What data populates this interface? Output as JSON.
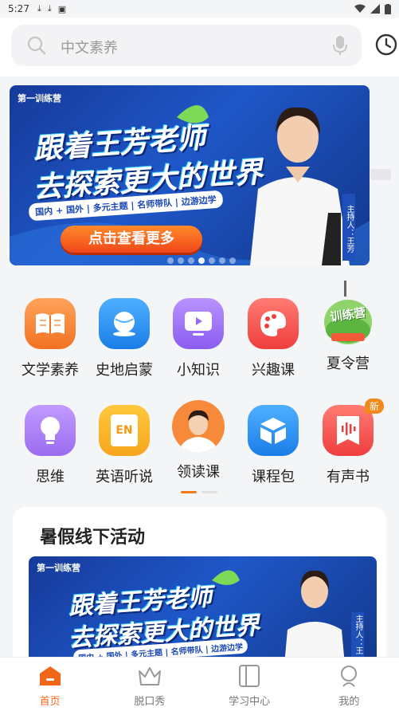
{
  "status_bar": {
    "time": "5:27"
  },
  "search": {
    "placeholder": "中文素养"
  },
  "banner": {
    "camp_label": "第一训练营",
    "headline_1": "跟着王芳老师",
    "headline_2": "去探索更大的世界",
    "tags": "国内 + 国外 | 多元主题 | 名师带队 | 边游边学",
    "cta": "点击查看更多",
    "host": "主持人：王芳",
    "slide_count": 7,
    "active_slide": 4
  },
  "grid_row1": [
    {
      "label": "文学素养",
      "icon": "book-icon",
      "color": "#f6893a"
    },
    {
      "label": "史地启蒙",
      "icon": "planet-icon",
      "color": "#2a8df2"
    },
    {
      "label": "小知识",
      "icon": "monitor-play-icon",
      "color": "#9b6cf0"
    },
    {
      "label": "兴趣课",
      "icon": "palette-icon",
      "color": "#f2564f"
    },
    {
      "label": "夏令营",
      "icon": "camp-illustration",
      "color": "#4bbf55",
      "art_text": "训练营"
    }
  ],
  "grid_row2": [
    {
      "label": "思维",
      "icon": "lightbulb-icon",
      "color": "#a672f0"
    },
    {
      "label": "英语听说",
      "icon": "english-book-icon",
      "color": "#f9b42a",
      "art_text": "EN"
    },
    {
      "label": "领读课",
      "icon": "teacher-avatar",
      "color": "#f6893a"
    },
    {
      "label": "课程包",
      "icon": "package-icon",
      "color": "#2a8df2"
    },
    {
      "label": "有声书",
      "icon": "audio-book-icon",
      "color": "#f2564f",
      "badge": "新"
    }
  ],
  "activity": {
    "title": "暑假线下活动",
    "camp_label": "第一训练营",
    "headline_1": "跟着王芳老师",
    "headline_2": "去探索更大的世界",
    "tags": "国内 + 国外 | 多元主题 | 名师带队 | 边游边学",
    "host": "主持人：王"
  },
  "tabs": [
    {
      "label": "首页",
      "icon": "home-icon",
      "active": true
    },
    {
      "label": "脱口秀",
      "icon": "crown-icon",
      "active": false
    },
    {
      "label": "学习中心",
      "icon": "book-panel-icon",
      "active": false
    },
    {
      "label": "我的",
      "icon": "profile-icon",
      "active": false
    }
  ],
  "colors": {
    "accent": "#f2661a",
    "banner_blue": "#1f57c8"
  }
}
